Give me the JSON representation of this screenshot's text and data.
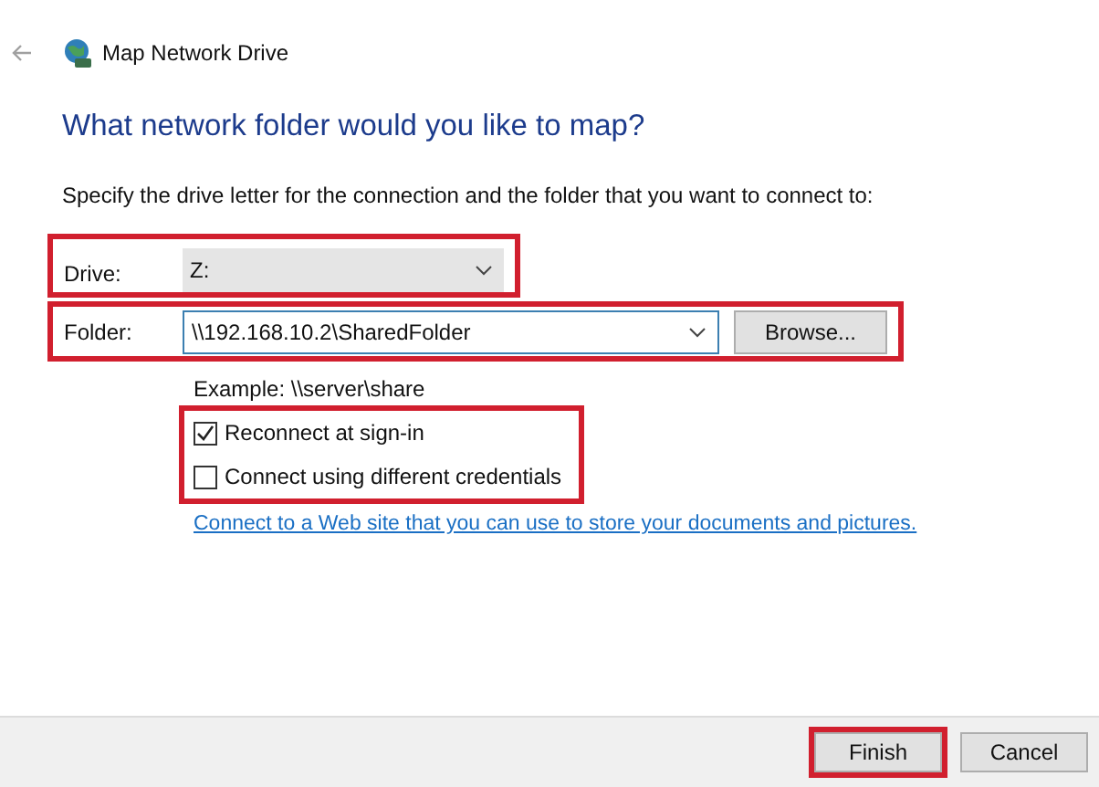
{
  "window": {
    "title": "Map Network Drive"
  },
  "heading": "What network folder would you like to map?",
  "instruction": "Specify the drive letter for the connection and the folder that you want to connect to:",
  "drive": {
    "label": "Drive:",
    "value": "Z:",
    "highlighted": true
  },
  "folder": {
    "label": "Folder:",
    "value": "\\\\192.168.10.2\\SharedFolder",
    "browse": "Browse...",
    "highlighted": true
  },
  "example": "Example: \\\\server\\share",
  "options": {
    "highlighted": true,
    "items": [
      {
        "label": "Reconnect at sign-in",
        "checked": true
      },
      {
        "label": "Connect using different credentials",
        "checked": false
      }
    ]
  },
  "link": "Connect to a Web site that you can use to store your documents and pictures.",
  "buttons": [
    {
      "label": "Finish",
      "highlighted": true
    },
    {
      "label": "Cancel",
      "highlighted": false
    }
  ]
}
